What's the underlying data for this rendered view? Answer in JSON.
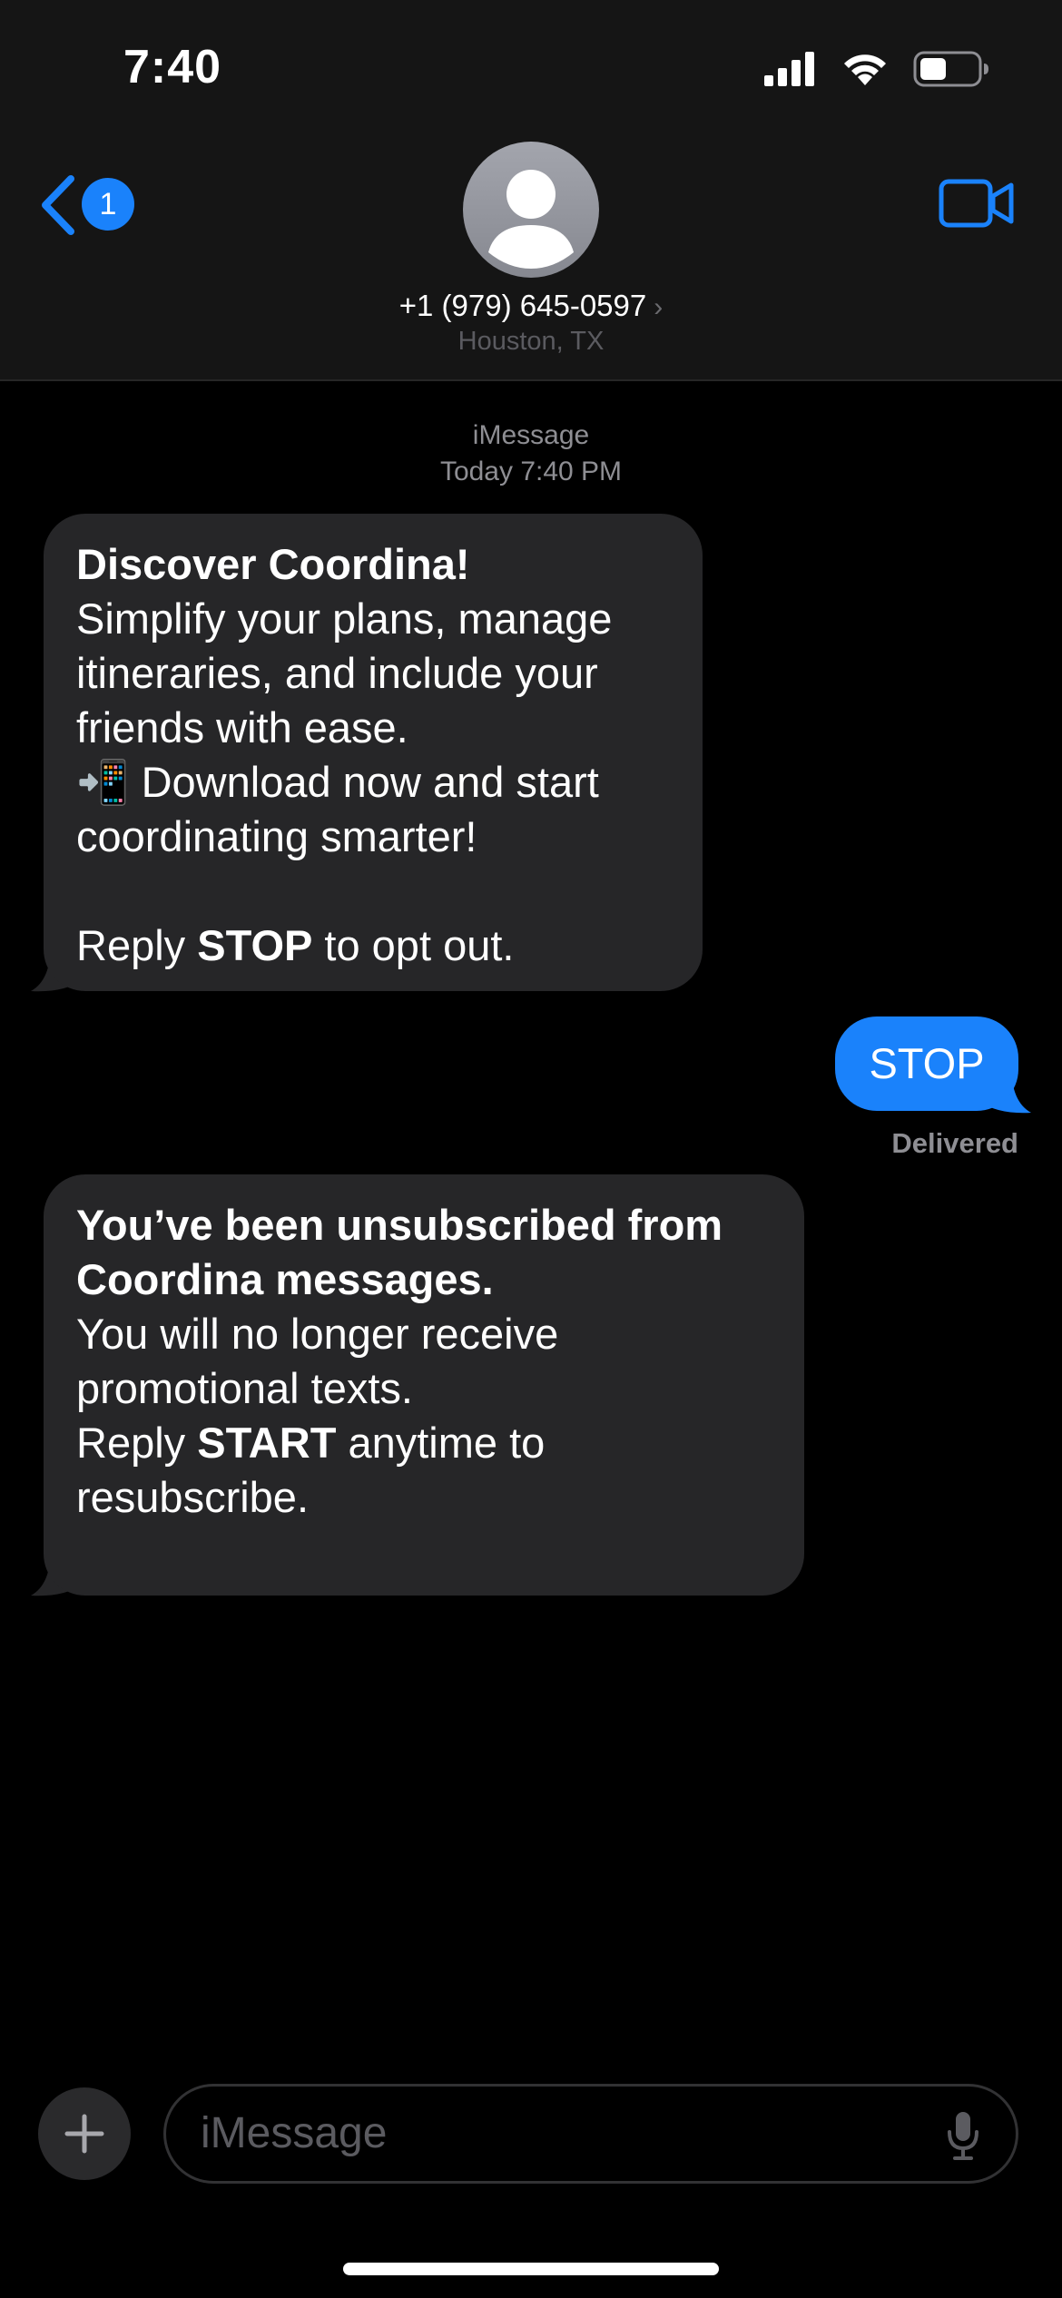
{
  "status_bar": {
    "time": "7:40"
  },
  "header": {
    "back_badge_count": "1",
    "contact_number": "+1 (979) 645-0597",
    "contact_location": "Houston, TX",
    "chevron": "›"
  },
  "conversation": {
    "service_label": "iMessage",
    "timestamp": "Today 7:40 PM",
    "messages": [
      {
        "direction": "incoming",
        "title": "Discover Coordina!",
        "lines": [
          "Simplify your plans, manage",
          "itineraries, and include your",
          "friends with ease."
        ],
        "emoji_line_icon": "📲",
        "emoji_line_text": " Download now and start",
        "line_after_emoji": "coordinating smarter!",
        "optout_prefix": "Reply ",
        "optout_keyword": "STOP",
        "optout_suffix": " to opt out."
      },
      {
        "direction": "outgoing",
        "text": "STOP",
        "status": "Delivered"
      },
      {
        "direction": "incoming",
        "title_line1": "You’ve been unsubscribed from",
        "title_line2": "Coordina messages.",
        "line1": "You will no longer receive",
        "line2": "promotional texts.",
        "resub_prefix": "Reply ",
        "resub_keyword": "START",
        "resub_suffix": " anytime to",
        "line_last": "resubscribe."
      }
    ]
  },
  "input_bar": {
    "placeholder": "iMessage",
    "plus_icon": "plus-icon",
    "mic_icon": "microphone-icon"
  },
  "colors": {
    "accent": "#1a82fb",
    "incoming_bubble": "#262628",
    "header_bg": "#151515",
    "secondary_text": "#8e8e93"
  }
}
